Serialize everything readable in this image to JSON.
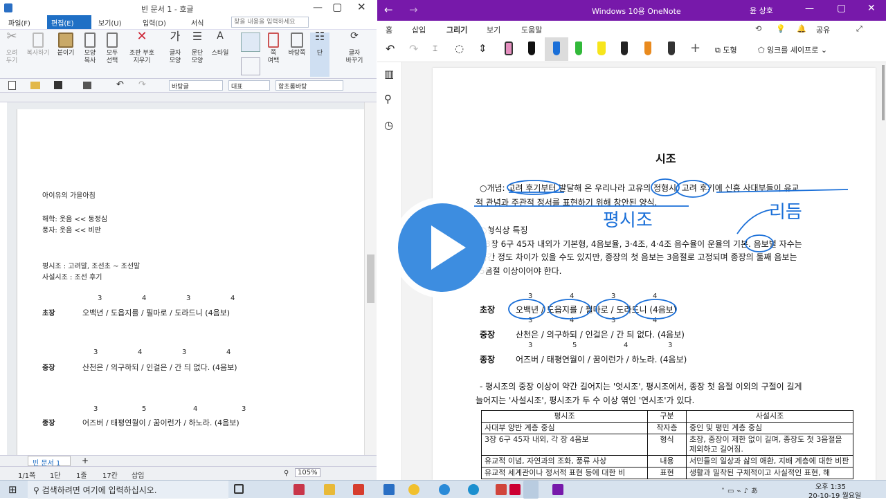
{
  "hwp": {
    "title": "빈 문서 1 - 호글",
    "menu": [
      "파일(F)",
      "편집(E)",
      "보기(U)",
      "입력(D)",
      "서식"
    ],
    "search_placeholder": "찾을 내용을 입력하세요",
    "ribbon": [
      {
        "label": "오려\n두기",
        "icon": "scissors-icon"
      },
      {
        "label": "복사하기",
        "icon": "copy-icon"
      },
      {
        "label": "붙이기",
        "icon": "paste-icon"
      },
      {
        "label": "모양\n복사",
        "icon": "format-painter-icon"
      },
      {
        "label": "모두\n선택",
        "icon": "select-all-icon"
      },
      {
        "label": "조판 부호\n지우기",
        "icon": "clear-format-icon"
      },
      {
        "label": "글자\n모양",
        "icon": "char-shape-icon"
      },
      {
        "label": "문단\n모양",
        "icon": "para-shape-icon"
      },
      {
        "label": "스타일",
        "icon": "style-icon"
      },
      {
        "label": "쪽\n여백",
        "icon": "page-margin-icon"
      },
      {
        "label": "바탕쪽",
        "icon": "master-page-icon"
      },
      {
        "label": "단",
        "icon": "columns-icon"
      },
      {
        "label": "글자\n바꾸기",
        "icon": "replace-icon"
      }
    ],
    "toolbar": {
      "style": "바탕글",
      "lang": "대표",
      "font": "함초롬바탕"
    },
    "doc": {
      "line1": "아이유의 가을아침",
      "line2": "해학: 웃음 << 동정심",
      "line3": "풍자: 웃음 << 비판",
      "line4": "평시조 : 고려말, 조선초 ~ 조선말",
      "line5": "사설시조 : 조선 후기",
      "rows": [
        {
          "head": "초장",
          "text": "오백년 / 도읍지를 / 필마로 / 도라드니 (4음보)",
          "nums": [
            "3",
            "4",
            "3",
            "4"
          ]
        },
        {
          "head": "중장",
          "text": "산천은 / 의구하되 / 인걸은 / 간 듸 없다. (4음보)",
          "nums": [
            "3",
            "4",
            "3",
            "4"
          ]
        },
        {
          "head": "종장",
          "text": "어즈버 / 태평연월이 / 꿈이런가 / 하노라. (4음보)",
          "nums": [
            "3",
            "5",
            "4",
            "3"
          ]
        }
      ]
    },
    "tab": "빈 문서 1",
    "status": [
      "1/1쪽",
      "1단",
      "1줄",
      "17칸",
      "삽입",
      "105%"
    ]
  },
  "onenote": {
    "title": "Windows 10용 OneNote",
    "user": "윤 상호",
    "tabs": [
      "홈",
      "삽입",
      "그리기",
      "보기",
      "도움말"
    ],
    "share": "공유",
    "draw_tools": {
      "shape": "도형",
      "ink_to_shape": "잉크를 셰이프로"
    },
    "page": {
      "title": "시조",
      "concept": "○개념: 고려 후기부터 발달해 온 우리나라 고유의 정형시. 고려 후기에 신흥 사대부들이 유교",
      "concept2": "적 관념과 주관적 정서를 표현하기 위해 창안된 양식.",
      "form_head": "○형식상 특징",
      "form1": "- 3장 6구 45자 내외가 기본형, 4음보율, 3·4조, 4·4조 음수율이 운율의 기본. 음보별 자수는",
      "form2": "약간 정도 차이가 있을 수도 있지만, 종장의 첫 음보는 3음절로 고정되며 종장의 둘째 음보는",
      "form3": "5음절 이상이어야 한다.",
      "rows": [
        {
          "head": "초장",
          "text": "오백년 / 도읍지를 / 필마로 / 도라드니 (4음보)",
          "nums": [
            "3",
            "4",
            "3",
            "4"
          ]
        },
        {
          "head": "중장",
          "text": "산천은 / 의구하되 / 인걸은 / 간 듸 없다. (4음보)",
          "nums": [
            "3",
            "4",
            "3",
            "4"
          ]
        },
        {
          "head": "종장",
          "text": "어즈버 / 태평연월이 / 꿈이런가 / 하노라. (4음보)",
          "nums": [
            "3",
            "5",
            "4",
            "3"
          ]
        }
      ],
      "note1": "- 평시조의 중장 이상이 약간 길어지는 '엇시조', 평시조에서, 종장 첫 음절 이외의 구절이 길게",
      "note2": "늘어지는 '사설시조', 평시조가 두 수 이상 엮인 '연시조'가 있다.",
      "table": {
        "headers": [
          "평시조",
          "구분",
          "사설시조"
        ],
        "rows": [
          [
            "사대부 양반 계층 중심",
            "작자층",
            "중인 및 평민 계층 중심"
          ],
          [
            "3장 6구 45자 내외, 각 장 4음보",
            "형식",
            "초장, 중장이 제한 없이 길며, 종장도 첫 3음절을 제외하고 길어짐."
          ],
          [
            "유교적 이념, 자연과의 조화, 풍류 사상",
            "내용",
            "서민들의 일상과 삶의 애환, 지배 계층에 대한 비판"
          ],
          [
            "유교적 세계관이나 정서적 표현 등에 대한 비",
            "표현",
            "생활과 밀착된 구체적이고 사실적인 표현, 해"
          ]
        ]
      },
      "handwriting": [
        "평시조",
        "리듬"
      ]
    }
  },
  "taskbar": {
    "search": "검색하려면 여기에 입력하십시오.",
    "time": "오후 1:35",
    "date": "20-10-19 월요일"
  },
  "colors": {
    "onenote_purple": "#7719aa",
    "ink_blue": "#1a6fd8",
    "play_blue": "#3d8de0",
    "hwp_active_menu": "#1f6fc5"
  }
}
